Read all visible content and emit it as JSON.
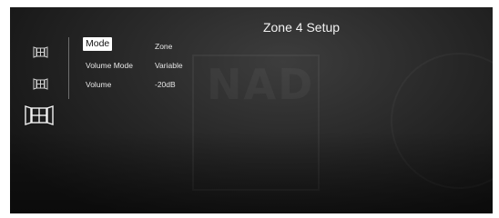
{
  "title": "Zone 4 Setup",
  "watermark": {
    "logo_text": "NAD"
  },
  "sidebar": {
    "icons": [
      "zone-2-icon",
      "zone-3-icon",
      "zone-4-icon"
    ]
  },
  "menu": {
    "rows": [
      {
        "label": "Mode",
        "value": "Zone",
        "selected": true
      },
      {
        "label": "Volume Mode",
        "value": "Variable"
      },
      {
        "label": "Volume",
        "value": "-20dB"
      }
    ]
  },
  "colors": {
    "background": "#262626",
    "text": "#e6e6e6",
    "highlight": "#ffffff"
  }
}
